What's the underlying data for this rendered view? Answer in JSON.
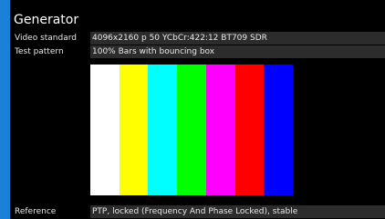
{
  "generator": {
    "title": "Generator",
    "video_standard": {
      "label": "Video standard",
      "value": "4096x2160 p 50 YCbCr:422:12 BT709 SDR"
    },
    "test_pattern": {
      "label": "Test pattern",
      "value": "100% Bars with bouncing box"
    },
    "reference": {
      "label": "Reference",
      "value": "PTP, locked (Frequency And Phase Locked), stable"
    },
    "pattern_bars": [
      "#ffffff",
      "#ffff00",
      "#00ffff",
      "#00ff00",
      "#ff00ff",
      "#ff0000",
      "#0000ff"
    ]
  },
  "colors": {
    "background": "#1a80d8",
    "panel": "#000000",
    "field": "#2c2c2c"
  }
}
